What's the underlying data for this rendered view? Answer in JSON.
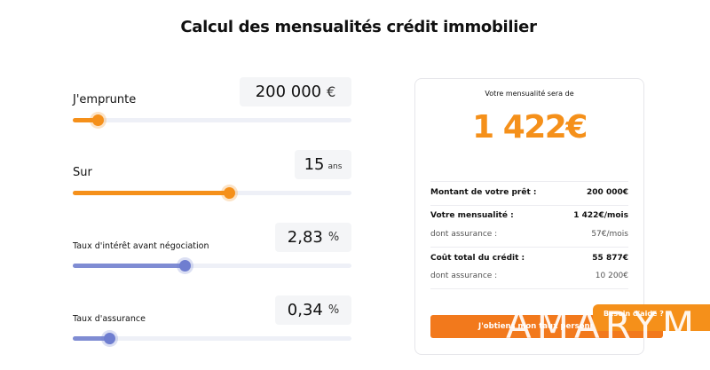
{
  "page": {
    "title": "Calcul des mensualités crédit immobilier"
  },
  "sliders": {
    "amount": {
      "label": "J'emprunte",
      "value": "200 000",
      "unit": "€",
      "fraction": 0.09
    },
    "duration": {
      "label": "Sur",
      "value": "15",
      "unit": "ans",
      "fraction": 0.56
    },
    "rate": {
      "label": "Taux d'intérêt avant négociation",
      "value": "2,83",
      "unit": "%",
      "fraction": 0.4
    },
    "insurance": {
      "label": "Taux d'assurance",
      "value": "0,34",
      "unit": "%",
      "fraction": 0.13
    }
  },
  "result": {
    "caption": "Votre mensualité sera de",
    "amount": "1 422€",
    "rows": [
      {
        "label": "Montant de votre prêt :",
        "value": "200 000€"
      },
      {
        "label": "Votre mensualité :",
        "value": "1 422€/mois"
      },
      {
        "label": "dont assurance :",
        "value": "57€/mois"
      },
      {
        "label": "Coût total du crédit :",
        "value": "55 877€"
      },
      {
        "label": "dont assurance :",
        "value": "10 200€"
      }
    ],
    "cta_label": "J'obtiens mon taux personnalisé"
  },
  "help": {
    "label": "Besoin d'aide ?"
  },
  "watermark": {
    "text": "AMARYM"
  },
  "colors": {
    "accent": "#f5901a",
    "slider_blue": "#6f7ed0",
    "cta": "#f2791c"
  }
}
